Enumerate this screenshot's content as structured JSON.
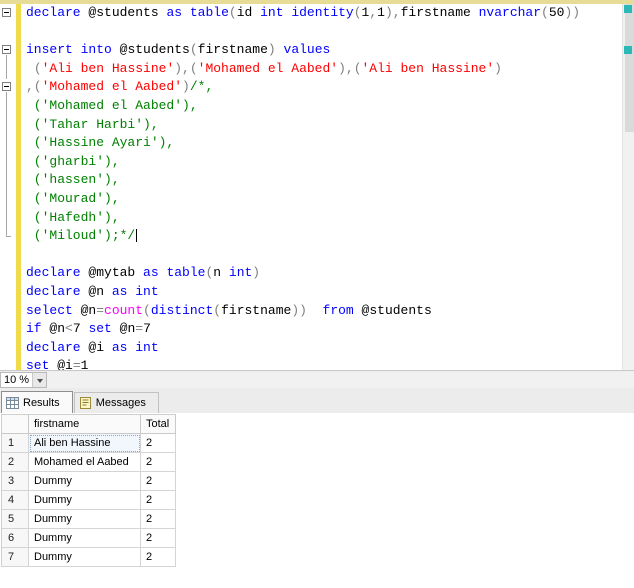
{
  "colors": {
    "keyword": "#0000ff",
    "string": "#ff0000",
    "comment": "#008000",
    "function": "#ff00ff",
    "operator": "#7f7f7f",
    "plain": "#000000",
    "change_bar": "#f0dc4b",
    "scroll_annotation": "#2db8b8"
  },
  "editor": {
    "lines": [
      {
        "fold": "minus",
        "tokens": [
          [
            "k",
            "declare"
          ],
          [
            "p",
            " @students "
          ],
          [
            "k",
            "as"
          ],
          [
            "p",
            " "
          ],
          [
            "k",
            "table"
          ],
          [
            "o",
            "("
          ],
          [
            "p",
            "id "
          ],
          [
            "k",
            "int"
          ],
          [
            "p",
            " "
          ],
          [
            "k",
            "identity"
          ],
          [
            "o",
            "("
          ],
          [
            "p",
            "1"
          ],
          [
            "o",
            ","
          ],
          [
            "p",
            "1"
          ],
          [
            "o",
            ")"
          ],
          [
            "o",
            ","
          ],
          [
            "p",
            "firstname "
          ],
          [
            "k",
            "nvarchar"
          ],
          [
            "o",
            "("
          ],
          [
            "p",
            "50"
          ],
          [
            "o",
            "))"
          ]
        ]
      },
      {
        "tokens": []
      },
      {
        "fold": "minus",
        "tokens": [
          [
            "k",
            "insert"
          ],
          [
            "p",
            " "
          ],
          [
            "k",
            "into"
          ],
          [
            "p",
            " @students"
          ],
          [
            "o",
            "("
          ],
          [
            "p",
            "firstname"
          ],
          [
            "o",
            ")"
          ],
          [
            "p",
            " "
          ],
          [
            "k",
            "values"
          ]
        ]
      },
      {
        "guide": true,
        "tokens": [
          [
            "p",
            " "
          ],
          [
            "o",
            "("
          ],
          [
            "s",
            "'Ali ben Hassine'"
          ],
          [
            "o",
            "),("
          ],
          [
            "s",
            "'Mohamed el Aabed'"
          ],
          [
            "o",
            "),("
          ],
          [
            "s",
            "'Ali ben Hassine'"
          ],
          [
            "o",
            ")"
          ]
        ]
      },
      {
        "fold": "minus",
        "tokens": [
          [
            "o",
            ",("
          ],
          [
            "s",
            "'Mohamed el Aabed'"
          ],
          [
            "o",
            ")"
          ],
          [
            "c",
            "/*,"
          ]
        ]
      },
      {
        "guide": true,
        "tokens": [
          [
            "c",
            " ('Mohamed el Aabed'),"
          ]
        ]
      },
      {
        "guide": true,
        "tokens": [
          [
            "c",
            " ('Tahar Harbi'),"
          ]
        ]
      },
      {
        "guide": true,
        "tokens": [
          [
            "c",
            " ('Hassine Ayari'),"
          ]
        ]
      },
      {
        "guide": true,
        "tokens": [
          [
            "c",
            " ('gharbi'),"
          ]
        ]
      },
      {
        "guide": true,
        "tokens": [
          [
            "c",
            " ('hassen'),"
          ]
        ]
      },
      {
        "guide": true,
        "tokens": [
          [
            "c",
            " ('Mourad'),"
          ]
        ]
      },
      {
        "guide": true,
        "tokens": [
          [
            "c",
            " ('Hafedh'),"
          ]
        ]
      },
      {
        "guide": "end",
        "caret": true,
        "tokens": [
          [
            "c",
            " ('Miloud');*/"
          ]
        ]
      },
      {
        "tokens": []
      },
      {
        "tokens": [
          [
            "k",
            "declare"
          ],
          [
            "p",
            " @mytab "
          ],
          [
            "k",
            "as"
          ],
          [
            "p",
            " "
          ],
          [
            "k",
            "table"
          ],
          [
            "o",
            "("
          ],
          [
            "p",
            "n "
          ],
          [
            "k",
            "int"
          ],
          [
            "o",
            ")"
          ]
        ]
      },
      {
        "tokens": [
          [
            "k",
            "declare"
          ],
          [
            "p",
            " @n "
          ],
          [
            "k",
            "as"
          ],
          [
            "p",
            " "
          ],
          [
            "k",
            "int"
          ]
        ]
      },
      {
        "tokens": [
          [
            "k",
            "select"
          ],
          [
            "p",
            " @n"
          ],
          [
            "o",
            "="
          ],
          [
            "f",
            "count"
          ],
          [
            "o",
            "("
          ],
          [
            "k",
            "distinct"
          ],
          [
            "o",
            "("
          ],
          [
            "p",
            "firstname"
          ],
          [
            "o",
            "))"
          ],
          [
            "p",
            "  "
          ],
          [
            "k",
            "from"
          ],
          [
            "p",
            " @students"
          ]
        ]
      },
      {
        "tokens": [
          [
            "k",
            "if"
          ],
          [
            "p",
            " @n"
          ],
          [
            "o",
            "<"
          ],
          [
            "p",
            "7 "
          ],
          [
            "k",
            "set"
          ],
          [
            "p",
            " @n"
          ],
          [
            "o",
            "="
          ],
          [
            "p",
            "7"
          ]
        ]
      },
      {
        "tokens": [
          [
            "k",
            "declare"
          ],
          [
            "p",
            " @i "
          ],
          [
            "k",
            "as"
          ],
          [
            "p",
            " "
          ],
          [
            "k",
            "int"
          ]
        ]
      },
      {
        "tokens": [
          [
            "k",
            "set"
          ],
          [
            "p",
            " @i"
          ],
          [
            "o",
            "="
          ],
          [
            "p",
            "1"
          ]
        ]
      }
    ]
  },
  "statusbar": {
    "zoom": "10 %"
  },
  "results_pane": {
    "tabs": [
      {
        "label": "Results",
        "icon": "results-grid-icon",
        "active": true
      },
      {
        "label": "Messages",
        "icon": "messages-icon",
        "active": false
      }
    ],
    "grid": {
      "columns": [
        "firstname",
        "Total"
      ],
      "rows": [
        {
          "num": "1",
          "cells": [
            "Ali ben Hassine",
            "2"
          ],
          "selected": true
        },
        {
          "num": "2",
          "cells": [
            "Mohamed el Aabed",
            "2"
          ]
        },
        {
          "num": "3",
          "cells": [
            "Dummy",
            "2"
          ]
        },
        {
          "num": "4",
          "cells": [
            "Dummy",
            "2"
          ]
        },
        {
          "num": "5",
          "cells": [
            "Dummy",
            "2"
          ]
        },
        {
          "num": "6",
          "cells": [
            "Dummy",
            "2"
          ]
        },
        {
          "num": "7",
          "cells": [
            "Dummy",
            "2"
          ]
        }
      ]
    }
  }
}
